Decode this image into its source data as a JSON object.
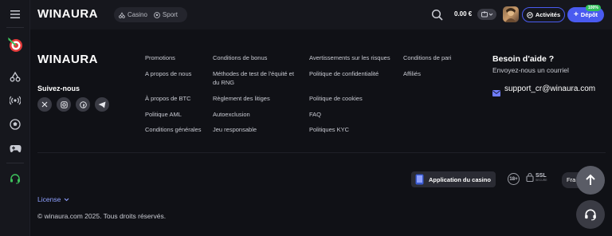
{
  "brand": {
    "logo": "WINAURA"
  },
  "topbar": {
    "casino_label": "Casino",
    "sport_label": "Sport",
    "balance": "0.00 €",
    "activities_label": "Activités",
    "deposit_label": "Dépôt",
    "deposit_badge": "100%"
  },
  "footer": {
    "follow_label": "Suivez-nous",
    "socials": [
      "x-icon",
      "instagram-icon",
      "facebook-icon",
      "telegram-icon"
    ],
    "col1": [
      "Promotions",
      "A propos de nous",
      "À propos de BTC",
      "Politique AML",
      "Conditions générales"
    ],
    "col2": [
      "Conditions de bonus",
      "Méthodes de test de l'équité et du RNG",
      "Règlement des litiges",
      "Autoexclusion",
      "Jeu responsable"
    ],
    "col3": [
      "Avertissements sur les risques",
      "Politique de confidentialité",
      "Politique de cookies",
      "FAQ",
      "Politiques KYC"
    ],
    "col4": [
      "Conditions de pari",
      "Affiliés"
    ],
    "help_title": "Besoin d'aide ?",
    "help_subtitle": "Envoyez-nous un courriel",
    "email": "support_cr@winaura.com",
    "app_button": "Application du casino",
    "age_label": "18+",
    "ssl_label": "SSL",
    "ssl_sub": "SECURE",
    "language": "Fra",
    "license_label": "License",
    "copyright": "© winaura.com 2025. Tous droits réservés."
  },
  "colors": {
    "accent": "#4a5bf0",
    "background": "#101116",
    "panel": "#16171d",
    "badge": "#2fbf5a",
    "link": "#8ea0ff"
  }
}
